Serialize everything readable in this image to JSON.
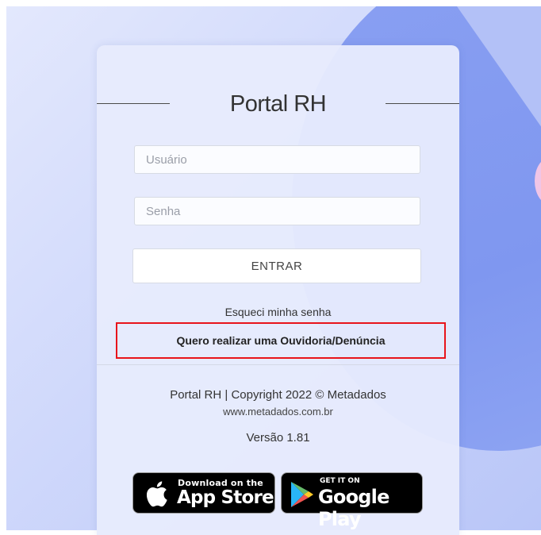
{
  "app": {
    "title": "Portal RH"
  },
  "login": {
    "username_placeholder": "Usuário",
    "password_placeholder": "Senha",
    "submit_label": "ENTRAR",
    "forgot_password": "Esqueci minha senha",
    "ouvidoria_link": "Quero realizar uma Ouvidoria/Denúncia"
  },
  "footer": {
    "copyright": "Portal RH | Copyright 2022 © Metadados",
    "website": "www.metadados.com.br",
    "version": "Versão 1.81"
  },
  "badges": {
    "app_store": {
      "small": "Download on the",
      "big": "App Store",
      "icon": "apple-icon"
    },
    "google_play": {
      "small": "GET IT ON",
      "big": "Google Play",
      "icon": "google-play-icon"
    }
  },
  "colors": {
    "highlight_border": "#e8141b",
    "background_blue": "#8aa0f2"
  }
}
